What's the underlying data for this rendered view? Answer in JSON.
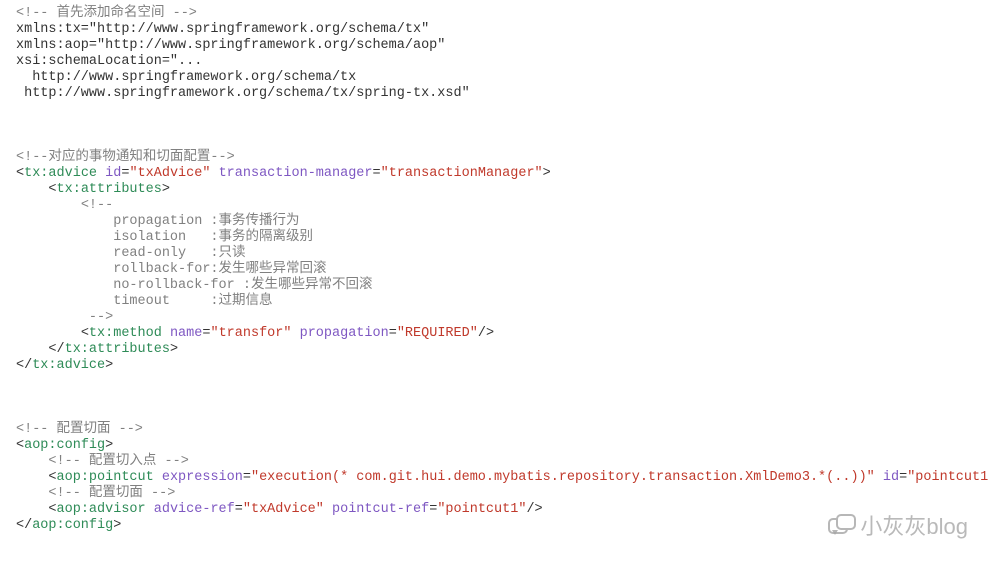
{
  "tokens": [
    {
      "cls": "c-comment",
      "t": "<!-- 首先添加命名空间 -->"
    },
    {
      "nl": 1
    },
    {
      "cls": "c-text",
      "t": "xmlns:tx=\"http://www.springframework.org/schema/tx\""
    },
    {
      "nl": 1
    },
    {
      "cls": "c-text",
      "t": "xmlns:aop=\"http://www.springframework.org/schema/aop\""
    },
    {
      "nl": 1
    },
    {
      "cls": "c-text",
      "t": "xsi:schemaLocation=\"..."
    },
    {
      "nl": 1
    },
    {
      "cls": "c-text",
      "t": "  http://www.springframework.org/schema/tx"
    },
    {
      "nl": 1
    },
    {
      "cls": "c-text",
      "t": " http://www.springframework.org/schema/tx/spring-tx.xsd\""
    },
    {
      "nl": 1
    },
    {
      "nl": 1
    },
    {
      "nl": 1
    },
    {
      "nl": 1
    },
    {
      "cls": "c-comment",
      "t": "<!--对应的事物通知和切面配置-->"
    },
    {
      "nl": 1
    },
    {
      "cls": "c-punct",
      "t": "<"
    },
    {
      "cls": "c-tag",
      "t": "tx:advice"
    },
    {
      "cls": "c-text",
      "t": " "
    },
    {
      "cls": "c-attr",
      "t": "id"
    },
    {
      "cls": "c-punct",
      "t": "="
    },
    {
      "cls": "c-str",
      "t": "\"txAdvice\""
    },
    {
      "cls": "c-text",
      "t": " "
    },
    {
      "cls": "c-attr",
      "t": "transaction-manager"
    },
    {
      "cls": "c-punct",
      "t": "="
    },
    {
      "cls": "c-str",
      "t": "\"transactionManager\""
    },
    {
      "cls": "c-punct",
      "t": ">"
    },
    {
      "nl": 1
    },
    {
      "cls": "c-text",
      "t": "    "
    },
    {
      "cls": "c-punct",
      "t": "<"
    },
    {
      "cls": "c-tag",
      "t": "tx:attributes"
    },
    {
      "cls": "c-punct",
      "t": ">"
    },
    {
      "nl": 1
    },
    {
      "cls": "c-text",
      "t": "        "
    },
    {
      "cls": "c-comment",
      "t": "<!--"
    },
    {
      "nl": 1
    },
    {
      "cls": "c-comment",
      "t": "            propagation :事务传播行为"
    },
    {
      "nl": 1
    },
    {
      "cls": "c-comment",
      "t": "            isolation   :事务的隔离级别"
    },
    {
      "nl": 1
    },
    {
      "cls": "c-comment",
      "t": "            read-only   :只读"
    },
    {
      "nl": 1
    },
    {
      "cls": "c-comment",
      "t": "            rollback-for:发生哪些异常回滚"
    },
    {
      "nl": 1
    },
    {
      "cls": "c-comment",
      "t": "            no-rollback-for :发生哪些异常不回滚"
    },
    {
      "nl": 1
    },
    {
      "cls": "c-comment",
      "t": "            timeout     :过期信息"
    },
    {
      "nl": 1
    },
    {
      "cls": "c-text",
      "t": "         "
    },
    {
      "cls": "c-comment",
      "t": "-->"
    },
    {
      "nl": 1
    },
    {
      "cls": "c-text",
      "t": "        "
    },
    {
      "cls": "c-punct",
      "t": "<"
    },
    {
      "cls": "c-tag",
      "t": "tx:method"
    },
    {
      "cls": "c-text",
      "t": " "
    },
    {
      "cls": "c-attr",
      "t": "name"
    },
    {
      "cls": "c-punct",
      "t": "="
    },
    {
      "cls": "c-str",
      "t": "\"transfor\""
    },
    {
      "cls": "c-text",
      "t": " "
    },
    {
      "cls": "c-attr",
      "t": "propagation"
    },
    {
      "cls": "c-punct",
      "t": "="
    },
    {
      "cls": "c-str",
      "t": "\"REQUIRED\""
    },
    {
      "cls": "c-punct",
      "t": "/>"
    },
    {
      "nl": 1
    },
    {
      "cls": "c-text",
      "t": "    "
    },
    {
      "cls": "c-punct",
      "t": "</"
    },
    {
      "cls": "c-tag",
      "t": "tx:attributes"
    },
    {
      "cls": "c-punct",
      "t": ">"
    },
    {
      "nl": 1
    },
    {
      "cls": "c-punct",
      "t": "</"
    },
    {
      "cls": "c-tag",
      "t": "tx:advice"
    },
    {
      "cls": "c-punct",
      "t": ">"
    },
    {
      "nl": 1
    },
    {
      "nl": 1
    },
    {
      "nl": 1
    },
    {
      "nl": 1
    },
    {
      "cls": "c-comment",
      "t": "<!-- 配置切面 -->"
    },
    {
      "nl": 1
    },
    {
      "cls": "c-punct",
      "t": "<"
    },
    {
      "cls": "c-tag",
      "t": "aop:config"
    },
    {
      "cls": "c-punct",
      "t": ">"
    },
    {
      "nl": 1
    },
    {
      "cls": "c-text",
      "t": "    "
    },
    {
      "cls": "c-comment",
      "t": "<!-- 配置切入点 -->"
    },
    {
      "nl": 1
    },
    {
      "cls": "c-text",
      "t": "    "
    },
    {
      "cls": "c-punct",
      "t": "<"
    },
    {
      "cls": "c-tag",
      "t": "aop:pointcut"
    },
    {
      "cls": "c-text",
      "t": " "
    },
    {
      "cls": "c-attr",
      "t": "expression"
    },
    {
      "cls": "c-punct",
      "t": "="
    },
    {
      "cls": "c-str",
      "t": "\"execution(* com.git.hui.demo.mybatis.repository.transaction.XmlDemo3.*(..))\""
    },
    {
      "cls": "c-text",
      "t": " "
    },
    {
      "cls": "c-attr",
      "t": "id"
    },
    {
      "cls": "c-punct",
      "t": "="
    },
    {
      "cls": "c-str",
      "t": "\"pointcut1\""
    },
    {
      "cls": "c-punct",
      "t": "/>"
    },
    {
      "nl": 1
    },
    {
      "cls": "c-text",
      "t": "    "
    },
    {
      "cls": "c-comment",
      "t": "<!-- 配置切面 -->"
    },
    {
      "nl": 1
    },
    {
      "cls": "c-text",
      "t": "    "
    },
    {
      "cls": "c-punct",
      "t": "<"
    },
    {
      "cls": "c-tag",
      "t": "aop:advisor"
    },
    {
      "cls": "c-text",
      "t": " "
    },
    {
      "cls": "c-attr",
      "t": "advice-ref"
    },
    {
      "cls": "c-punct",
      "t": "="
    },
    {
      "cls": "c-str",
      "t": "\"txAdvice\""
    },
    {
      "cls": "c-text",
      "t": " "
    },
    {
      "cls": "c-attr",
      "t": "pointcut-ref"
    },
    {
      "cls": "c-punct",
      "t": "="
    },
    {
      "cls": "c-str",
      "t": "\"pointcut1\""
    },
    {
      "cls": "c-punct",
      "t": "/>"
    },
    {
      "nl": 1
    },
    {
      "cls": "c-punct",
      "t": "</"
    },
    {
      "cls": "c-tag",
      "t": "aop:config"
    },
    {
      "cls": "c-punct",
      "t": ">"
    },
    {
      "nl": 1
    }
  ],
  "watermark": "小灰灰blog"
}
